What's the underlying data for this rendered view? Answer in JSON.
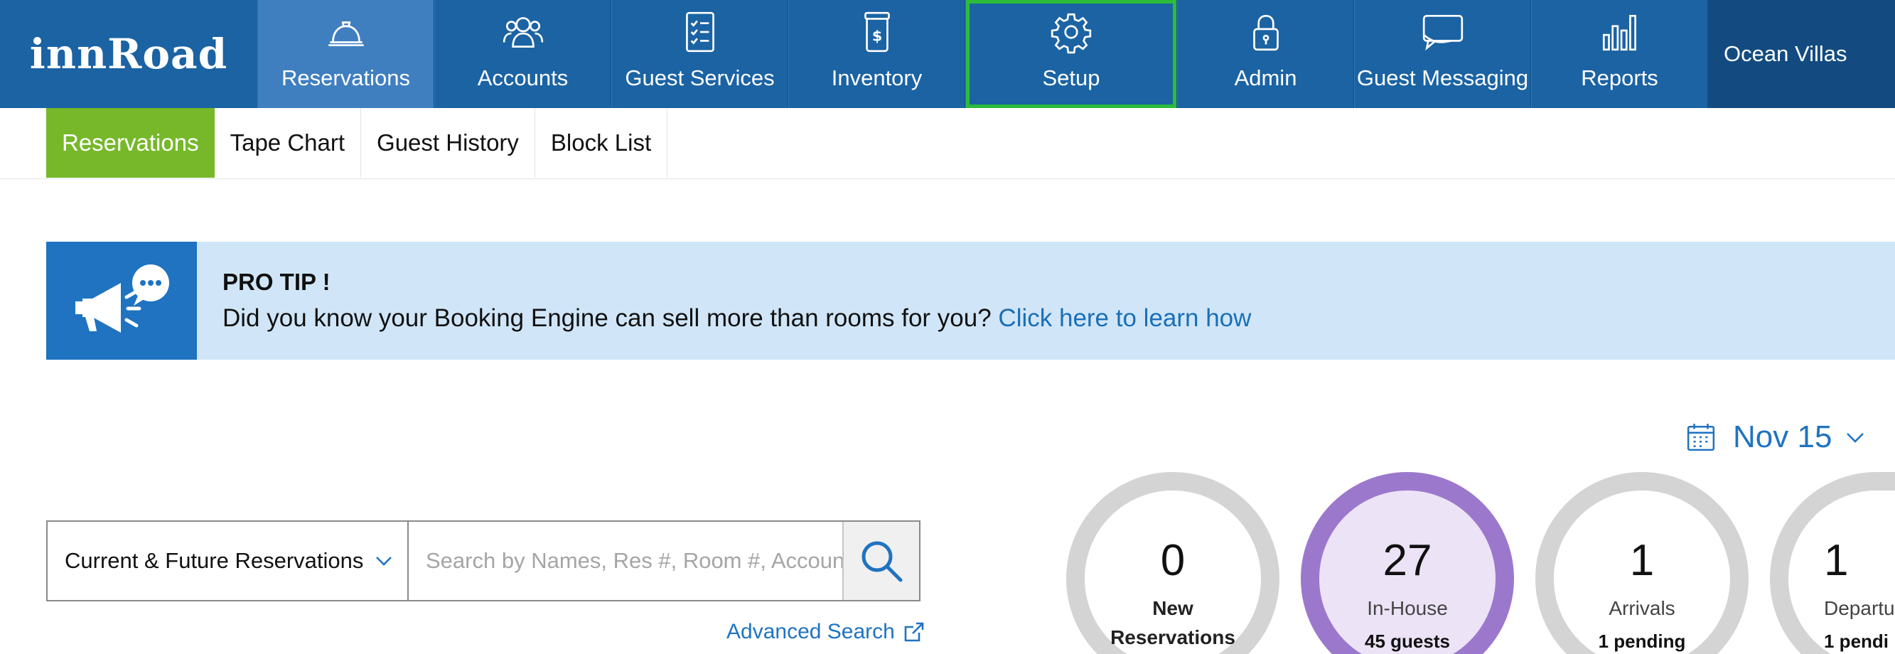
{
  "brand": {
    "logo": "innRoad"
  },
  "topnav": {
    "items": [
      {
        "label": "Reservations",
        "icon": "bell-icon"
      },
      {
        "label": "Accounts",
        "icon": "users-icon"
      },
      {
        "label": "Guest Services",
        "icon": "checklist-icon"
      },
      {
        "label": "Inventory",
        "icon": "dollar-jar-icon"
      },
      {
        "label": "Setup",
        "icon": "gear-icon"
      },
      {
        "label": "Admin",
        "icon": "lock-icon"
      },
      {
        "label": "Guest Messaging",
        "icon": "chat-icon"
      },
      {
        "label": "Reports",
        "icon": "bar-chart-icon"
      }
    ],
    "active": "Reservations",
    "highlighted": "Setup",
    "property_name": "Ocean Villas"
  },
  "subnav": {
    "tabs": [
      "Reservations",
      "Tape Chart",
      "Guest History",
      "Block List"
    ],
    "active": "Reservations"
  },
  "protip": {
    "title": "PRO TIP !",
    "text": "Did you know your Booking Engine can sell more than rooms for you?",
    "link": "Click here to learn how"
  },
  "date_selector": {
    "label": "Nov 15"
  },
  "search": {
    "filter": "Current & Future Reservations",
    "placeholder": "Search by Names, Res #, Room #, Account",
    "advanced_label": "Advanced Search"
  },
  "stats": [
    {
      "value": "0",
      "label_line1": "New",
      "label_line2": "Reservations"
    },
    {
      "value": "27",
      "label": "In-House",
      "sub": "45 guests"
    },
    {
      "value": "1",
      "label": "Arrivals",
      "sub": "1 pending"
    },
    {
      "value": "1",
      "label": "Departu",
      "sub": "1 pendi"
    }
  ],
  "colors": {
    "nav_bg": "#1b63a3",
    "nav_active": "#3f7fc0",
    "property_bg": "#134b80",
    "highlight": "#2dbb3a",
    "subtab_active": "#76b82a",
    "protip_bg": "#d0e6f8",
    "accent_blue": "#1f73c1",
    "ring_purple": "#9c78cd",
    "ring_gray": "#d4d4d4"
  }
}
